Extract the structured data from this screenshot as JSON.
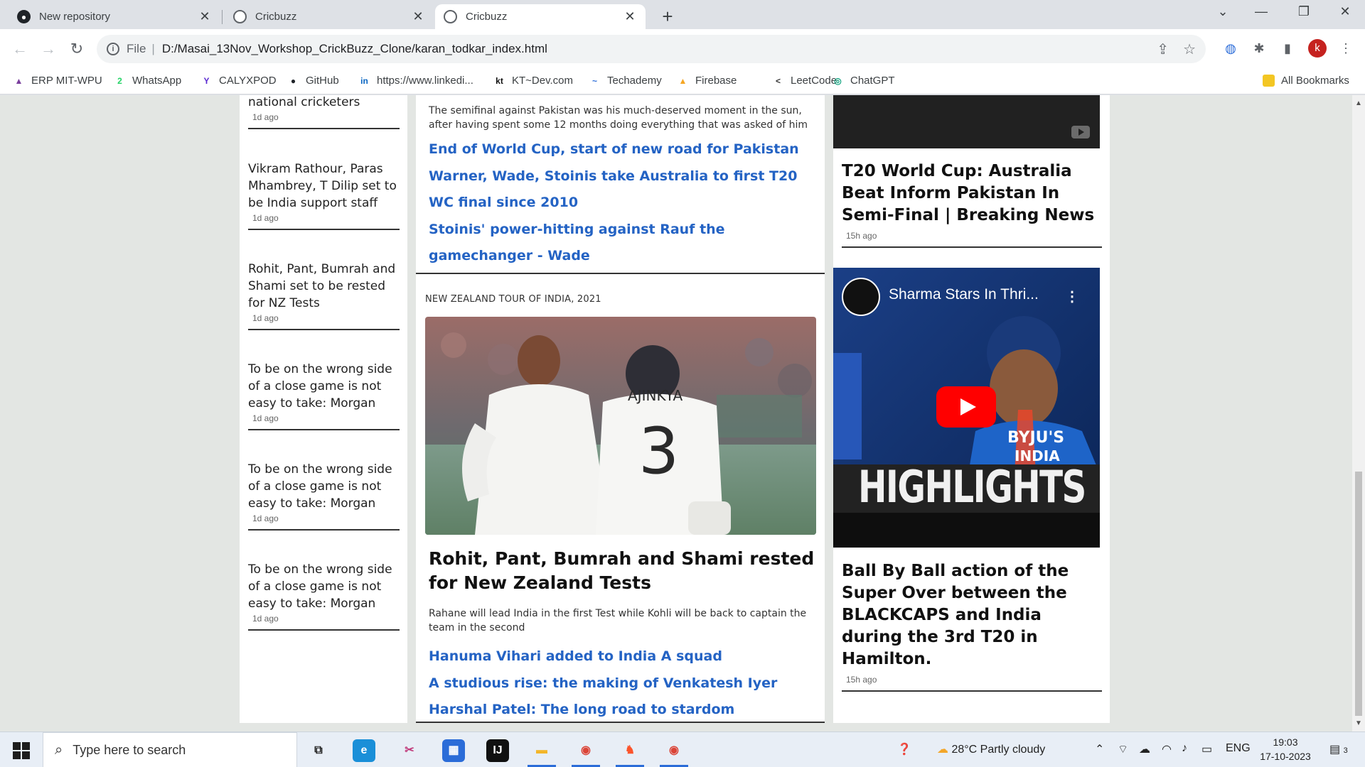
{
  "browser": {
    "tabs": [
      {
        "title": "New repository",
        "favicon": "github-icon",
        "active": false
      },
      {
        "title": "Cricbuzz",
        "favicon": "globe-icon",
        "active": false
      },
      {
        "title": "Cricbuzz",
        "favicon": "globe-icon",
        "active": true
      }
    ],
    "new_tab_glyph": "+",
    "close_glyph": "✕",
    "window_controls": {
      "minimize": "—",
      "maximize": "❐",
      "close": "✕",
      "dropdown": "⌄"
    },
    "nav": {
      "back": "←",
      "forward": "→",
      "reload": "↻"
    },
    "address": {
      "info_glyph": "i",
      "scheme": "File",
      "separator": "|",
      "url": "D:/Masai_13Nov_Workshop_CrickBuzz_Clone/karan_todkar_index.html"
    },
    "omnibox_actions": {
      "share": "⇪",
      "star": "☆"
    },
    "extensions": {
      "puzzle": "✱",
      "sidepanel": "▮",
      "avatar_letter": "k",
      "menu": "⋮"
    },
    "bookmarks": [
      {
        "label": "ERP MIT-WPU",
        "icon": "erp-icon",
        "glyph": "▲",
        "color": "#7a3e9d"
      },
      {
        "label": "WhatsApp",
        "icon": "whatsapp-icon",
        "glyph": "2",
        "color": "#25d366"
      },
      {
        "label": "CALYXPOD",
        "icon": "calyxpod-icon",
        "glyph": "Y",
        "color": "#5b2bd1"
      },
      {
        "label": "GitHub",
        "icon": "github-icon",
        "glyph": "●",
        "color": "#1f2328"
      },
      {
        "label": "https://www.linkedi...",
        "icon": "linkedin-icon",
        "glyph": "in",
        "color": "#0a66c2"
      },
      {
        "label": "KT~Dev.com",
        "icon": "kt-icon",
        "glyph": "kt",
        "color": "#111111"
      },
      {
        "label": "Techademy",
        "icon": "techademy-icon",
        "glyph": "~",
        "color": "#2b6cd8"
      },
      {
        "label": "Firebase",
        "icon": "firebase-icon",
        "glyph": "▲",
        "color": "#f5a623"
      },
      {
        "label": "LeetCode",
        "icon": "leetcode-icon",
        "glyph": "<",
        "color": "#333333"
      },
      {
        "label": "ChatGPT",
        "icon": "chatgpt-icon",
        "glyph": "◎",
        "color": "#10a37f"
      }
    ],
    "all_bookmarks": "All Bookmarks"
  },
  "page": {
    "left_news": [
      {
        "title": "national cricketers",
        "time": "1d ago"
      },
      {
        "title": "Vikram Rathour, Paras Mhambrey, T Dilip set to be India support staff",
        "time": "1d ago"
      },
      {
        "title": "Rohit, Pant, Bumrah and Shami set to be rested for NZ Tests",
        "time": "1d ago"
      },
      {
        "title": "To be on the wrong side of a close game is not easy to take: Morgan",
        "time": "1d ago"
      },
      {
        "title": "To be on the wrong side of a close game is not easy to take: Morgan",
        "time": "1d ago"
      },
      {
        "title": "To be on the wrong side of a close game is not easy to take: Morgan",
        "time": "1d ago"
      }
    ],
    "middle": {
      "top_description": "The semifinal against Pakistan was his much-deserved moment in the sun, after having spent some 12 months doing everything that was asked of him",
      "top_links": [
        "End of World Cup, start of new road for Pakistan",
        "Warner, Wade, Stoinis take Australia to first T20 WC final since 2010",
        "Stoinis' power-hitting against Rauf the gamechanger - Wade"
      ],
      "series_label": "NEW ZEALAND TOUR OF INDIA, 2021",
      "image_jersey_name": "AJINKYA",
      "image_jersey_number": "3",
      "headline": "Rohit, Pant, Bumrah and Shami rested for New Zealand Tests",
      "sub_description": "Rahane will lead India in the first Test while Kohli will be back to captain the team in the second",
      "bottom_links": [
        "Hanuma Vihari added to India A squad",
        "A studious rise: the making of Venkatesh Iyer",
        "Harshal Patel: The long road to stardom"
      ]
    },
    "right": {
      "video1_title": "T20 World Cup: Australia Beat Inform Pakistan In Semi-Final | Breaking News",
      "video1_time": "15h ago",
      "video2": {
        "title": "Sharma Stars In Thri...",
        "menu_glyph": "⋮",
        "overlay_text": "HIGHLIGHTS",
        "sponsor_text": "BYJU'S",
        "sponsor_sub": "INDIA"
      },
      "video2_caption": "Ball By Ball action of the Super Over between the BLACKCAPS and India during the 3rd T20 in Hamilton.",
      "video2_time": "15h ago"
    }
  },
  "taskbar": {
    "search_placeholder": "Type here to search",
    "search_glyph": "⌕",
    "apps": [
      {
        "name": "task-view-icon",
        "glyph": "⧉",
        "color": "#1d1d1d",
        "bg": "transparent"
      },
      {
        "name": "edge-icon",
        "glyph": "e",
        "color": "#ffffff",
        "bg": "#1a8fd8"
      },
      {
        "name": "snipping-icon",
        "glyph": "✂",
        "color": "#c0397a",
        "bg": "transparent"
      },
      {
        "name": "store-icon",
        "glyph": "▦",
        "color": "#ffffff",
        "bg": "#2b6cd8"
      },
      {
        "name": "intellij-icon",
        "glyph": "IJ",
        "color": "#ffffff",
        "bg": "#111111"
      },
      {
        "name": "file-explorer-icon",
        "glyph": "▬",
        "color": "#f3b629",
        "bg": "transparent"
      },
      {
        "name": "chrome-icon",
        "glyph": "◉",
        "color": "#db4437",
        "bg": "transparent"
      },
      {
        "name": "brave-icon",
        "glyph": "♞",
        "color": "#fb542b",
        "bg": "transparent"
      },
      {
        "name": "chrome-profile-icon",
        "glyph": "◉",
        "color": "#db4437",
        "bg": "transparent"
      }
    ],
    "weather": "28°C  Partly cloudy",
    "language": "ENG",
    "time": "19:03",
    "date": "17-10-2023",
    "notification_count": "3"
  }
}
